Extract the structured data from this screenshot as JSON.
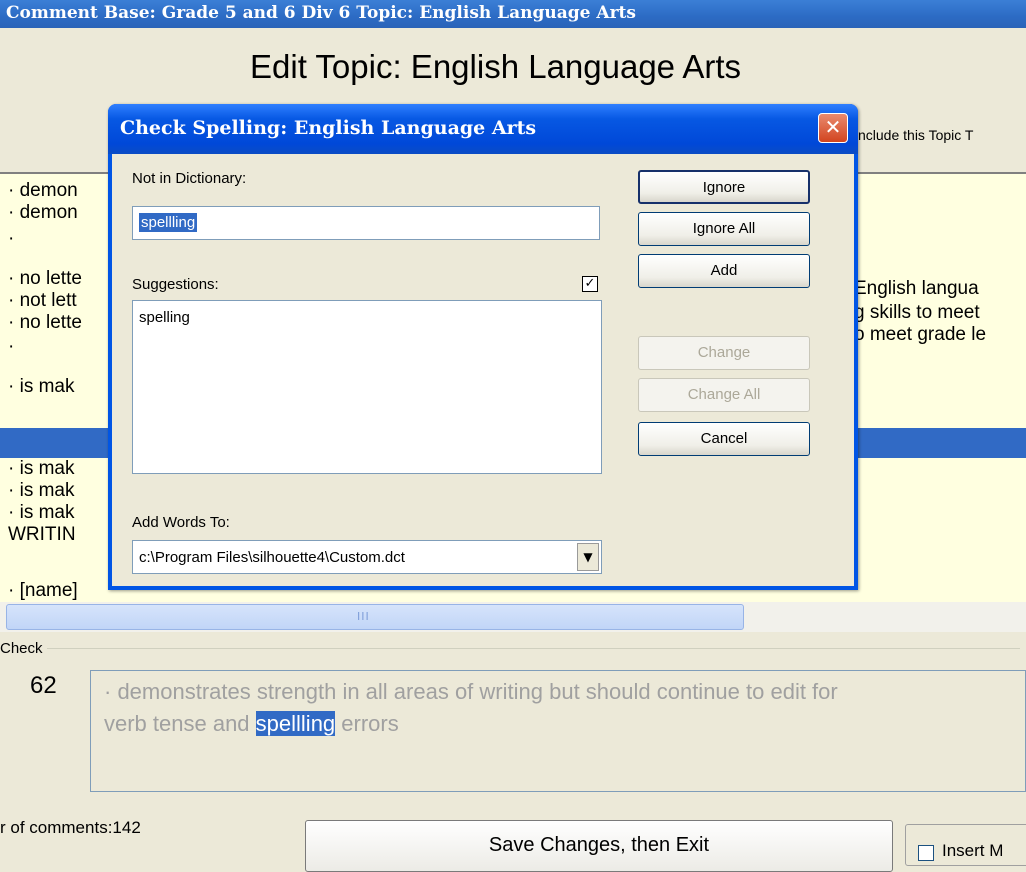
{
  "background_window": {
    "title": "Comment Base: Grade 5 and 6 Div 6  Topic: English Language Arts",
    "heading": "Edit Topic: English Language Arts",
    "include_label": "nclude this Topic T",
    "comment_rows": [
      "· demon",
      "· demon",
      "·",
      "· no lette",
      "· not lett",
      "· no lette",
      "·",
      "· is mak",
      "· is mak",
      "· is mak",
      "· is mak",
      "WRITIN",
      "· [name]"
    ],
    "right_fragments": [
      "English langua",
      "g skills to meet",
      "o meet grade le"
    ],
    "hscroll_grip": "III",
    "check_legend": "Check",
    "check_number": "62",
    "check_text_before": "· demonstrates strength in all areas of writing but should continue to edit for",
    "check_text_line2_before": "verb tense and ",
    "check_text_highlight": "spellling",
    "check_text_after": " errors",
    "comment_count": "r of comments:142",
    "save_button": "Save Changes, then Exit",
    "insert_label": "Insert M"
  },
  "dialog": {
    "title": "Check Spelling: English Language Arts",
    "close_glyph": "✕",
    "not_in_dictionary_label": "Not in Dictionary:",
    "not_in_dictionary_value": "spellling",
    "suggestions_label": "Suggestions:",
    "suggestions_checked": "✓",
    "suggestions": [
      "spelling"
    ],
    "add_words_label": "Add Words To:",
    "add_words_value": "c:\\Program Files\\silhouette4\\Custom.dct",
    "dropdown_arrow": "▼",
    "buttons": {
      "ignore": "Ignore",
      "ignore_all": "Ignore All",
      "add": "Add",
      "change": "Change",
      "change_all": "Change All",
      "cancel": "Cancel"
    }
  },
  "colors": {
    "selection": "#316AC5",
    "list_background": "#FFFFE0",
    "dialog_frame": "#0055E5",
    "close_button": "#D2441F"
  }
}
